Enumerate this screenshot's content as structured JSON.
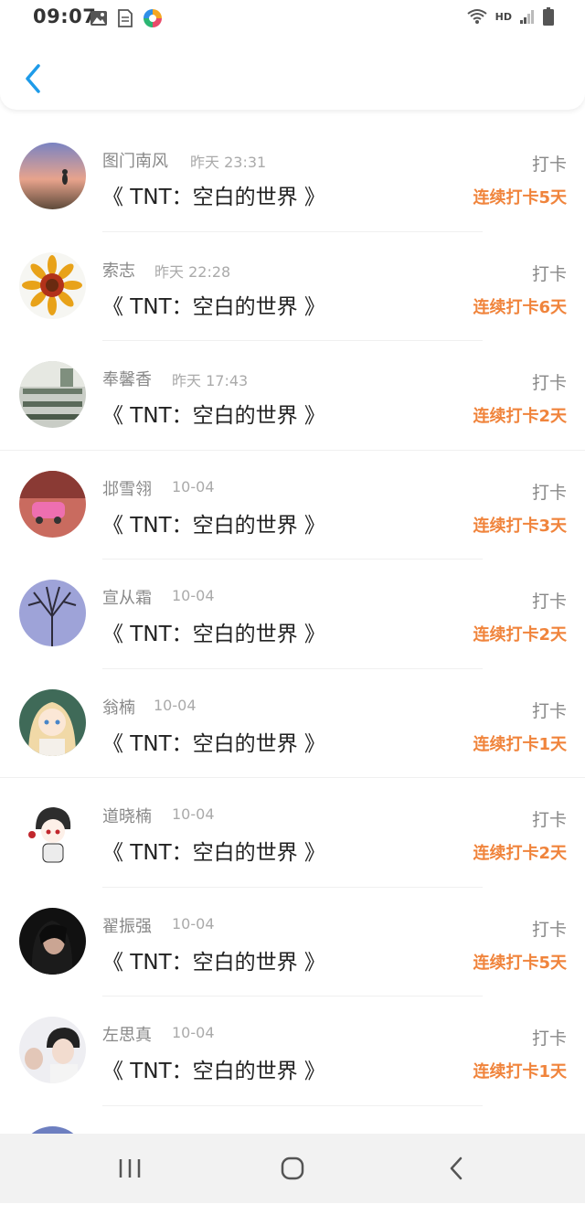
{
  "status_bar": {
    "time": "09:07",
    "hd": "HD",
    "icons": [
      "image-icon",
      "file-icon",
      "app-icon",
      "wifi-icon",
      "signal-icon",
      "battery-icon"
    ]
  },
  "header": {
    "back_icon": "chevron-left-icon",
    "accent_color": "#1e9be9"
  },
  "items": [
    {
      "user": "图门南风",
      "time": "昨天 23:31",
      "book": "《 TNT：空白的世界 》",
      "checkin": "打卡",
      "streak": "连续打卡5天"
    },
    {
      "user": "索志",
      "time": "昨天 22:28",
      "book": "《 TNT：空白的世界 》",
      "checkin": "打卡",
      "streak": "连续打卡6天"
    },
    {
      "user": "奉馨香",
      "time": "昨天 17:43",
      "book": "《 TNT：空白的世界 》",
      "checkin": "打卡",
      "streak": "连续打卡2天"
    },
    {
      "user": "邶雪翎",
      "time": "10-04",
      "book": "《 TNT：空白的世界 》",
      "checkin": "打卡",
      "streak": "连续打卡3天"
    },
    {
      "user": "宣从霜",
      "time": "10-04",
      "book": "《 TNT：空白的世界 》",
      "checkin": "打卡",
      "streak": "连续打卡2天"
    },
    {
      "user": "翁楠",
      "time": "10-04",
      "book": "《 TNT：空白的世界 》",
      "checkin": "打卡",
      "streak": "连续打卡1天"
    },
    {
      "user": "道晓楠",
      "time": "10-04",
      "book": "《 TNT：空白的世界 》",
      "checkin": "打卡",
      "streak": "连续打卡2天"
    },
    {
      "user": "翟振强",
      "time": "10-04",
      "book": "《 TNT：空白的世界 》",
      "checkin": "打卡",
      "streak": "连续打卡5天"
    },
    {
      "user": "左思真",
      "time": "10-04",
      "book": "《 TNT：空白的世界 》",
      "checkin": "打卡",
      "streak": "连续打卡1天"
    }
  ],
  "colors": {
    "streak": "#f0843c",
    "name": "#888888",
    "title": "#222222"
  },
  "nav_bar": {
    "icons": [
      "recent-apps-icon",
      "home-icon",
      "back-icon"
    ]
  }
}
